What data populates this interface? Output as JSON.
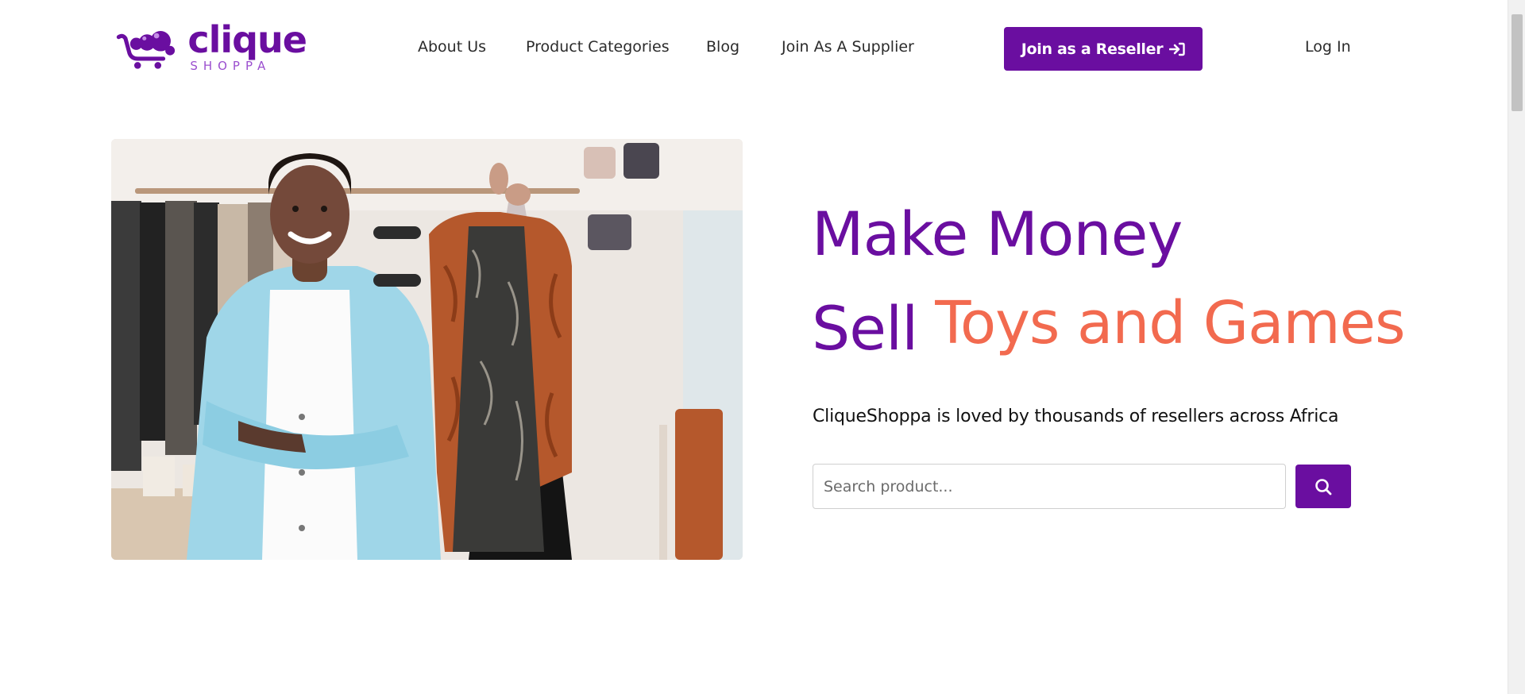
{
  "brand": {
    "name": "clique",
    "sub": "SHOPPA",
    "logo_icon": "shopping-cart-bubbles-icon",
    "primary_color": "#6a0ea0",
    "accent_color": "#f26a4f"
  },
  "nav": {
    "items": [
      {
        "label": "About Us"
      },
      {
        "label": "Product Categories"
      },
      {
        "label": "Blog"
      },
      {
        "label": "Join As A Supplier"
      }
    ],
    "reseller_label": "Join as a Reseller",
    "reseller_icon": "sign-in-icon",
    "login_label": "Log In"
  },
  "hero": {
    "image_label": "",
    "headline_line1": "Make Money",
    "headline_sell": "Sell",
    "headline_accent": "Toys and Games",
    "tagline": "CliqueShoppa is loved by thousands of resellers across Africa",
    "search": {
      "placeholder": "Search product...",
      "value": "",
      "button_icon": "search-icon"
    }
  }
}
